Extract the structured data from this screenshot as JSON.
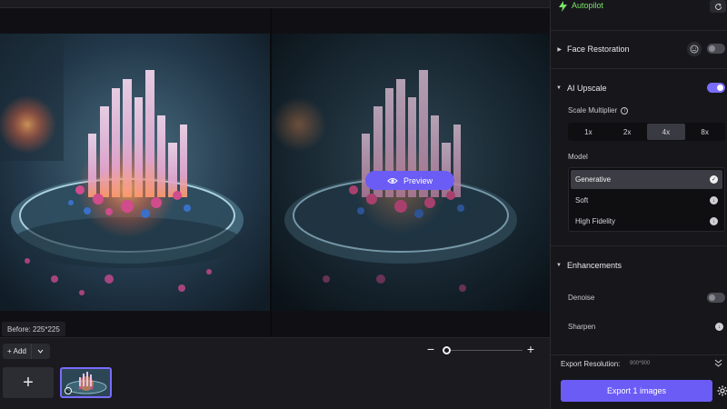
{
  "canvas": {
    "preview_label": "Preview",
    "before_label": "Before: 225*225"
  },
  "bottom_bar": {
    "add_label": "Add",
    "add_glyph": "+",
    "new_glyph": "+",
    "zoom_out_glyph": "−",
    "zoom_in_glyph": "+",
    "zoom_level": 0.0
  },
  "panel": {
    "autopilot": {
      "label": "Autopilot",
      "accent": "#7be26b"
    },
    "face_restoration": {
      "title": "Face Restoration",
      "enabled": false
    },
    "ai_upscale": {
      "title": "AI Upscale",
      "enabled": true,
      "scale_label": "Scale Multiplier",
      "scale_options": [
        "1x",
        "2x",
        "4x",
        "8x"
      ],
      "scale_selected": "4x",
      "model_label": "Model",
      "models": [
        {
          "name": "Generative",
          "selected": true
        },
        {
          "name": "Soft",
          "selected": false
        },
        {
          "name": "High Fidelity",
          "selected": false
        }
      ]
    },
    "enhancements": {
      "title": "Enhancements",
      "denoise_label": "Denoise",
      "denoise_enabled": false,
      "sharpen_label": "Sharpen"
    },
    "export": {
      "resolution_label": "Export Resolution:",
      "resolution_value": "900*900",
      "button_label": "Export 1 images"
    }
  },
  "colors": {
    "accent": "#6b5cf6",
    "toggle_on": "#7a6cff",
    "autopilot_green": "#7be26b"
  }
}
